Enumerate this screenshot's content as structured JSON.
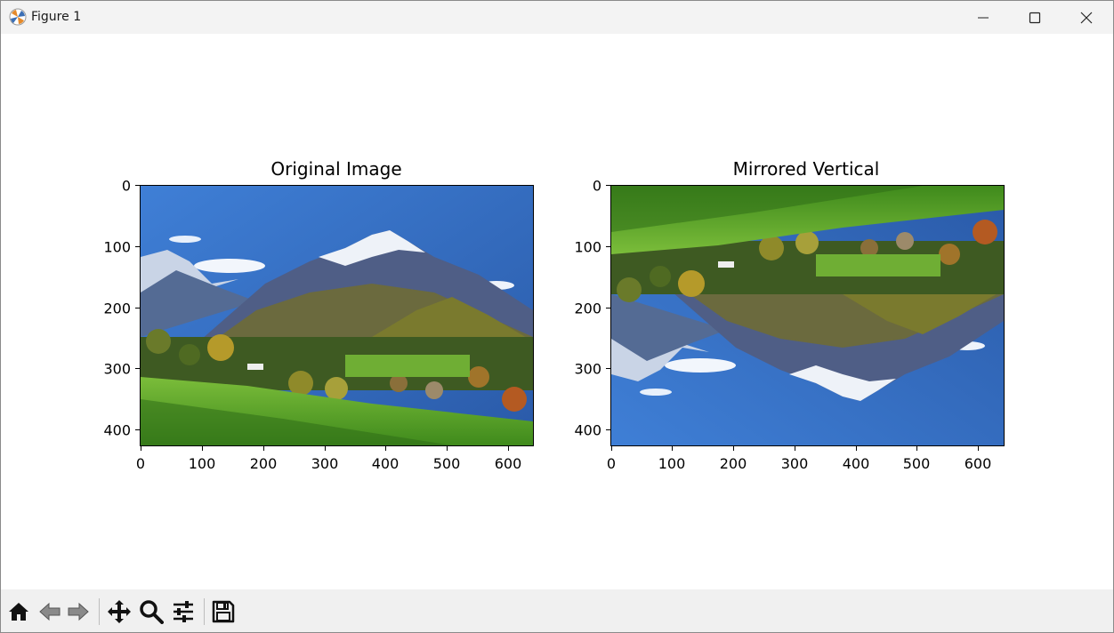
{
  "window": {
    "title": "Figure 1",
    "icons": {
      "app": "matplotlib-icon",
      "minimize": "minimize-icon",
      "maximize": "maximize-icon",
      "close": "close-icon"
    }
  },
  "figure": {
    "axes": [
      {
        "title": "Original Image",
        "image": "mountain-landscape-photo",
        "orientation": "normal",
        "xticks": [
          "0",
          "100",
          "200",
          "300",
          "400",
          "500",
          "600"
        ],
        "yticks": [
          "0",
          "100",
          "200",
          "300",
          "400"
        ]
      },
      {
        "title": "Mirrored Vertical",
        "image": "mountain-landscape-photo",
        "orientation": "flipped-vertical",
        "xticks": [
          "0",
          "100",
          "200",
          "300",
          "400",
          "500",
          "600"
        ],
        "yticks": [
          "0",
          "100",
          "200",
          "300",
          "400"
        ]
      }
    ]
  },
  "toolbar": {
    "tools": [
      {
        "name": "home",
        "icon": "home-icon"
      },
      {
        "name": "back",
        "icon": "back-arrow-icon"
      },
      {
        "name": "forward",
        "icon": "forward-arrow-icon"
      },
      {
        "name": "pan",
        "icon": "move-icon"
      },
      {
        "name": "zoom",
        "icon": "zoom-icon"
      },
      {
        "name": "configure",
        "icon": "sliders-icon"
      },
      {
        "name": "save",
        "icon": "save-icon"
      }
    ]
  },
  "colors": {
    "titlebar": "#f3f3f3",
    "toolbar": "#f0f0f0",
    "axes": "#000000"
  }
}
